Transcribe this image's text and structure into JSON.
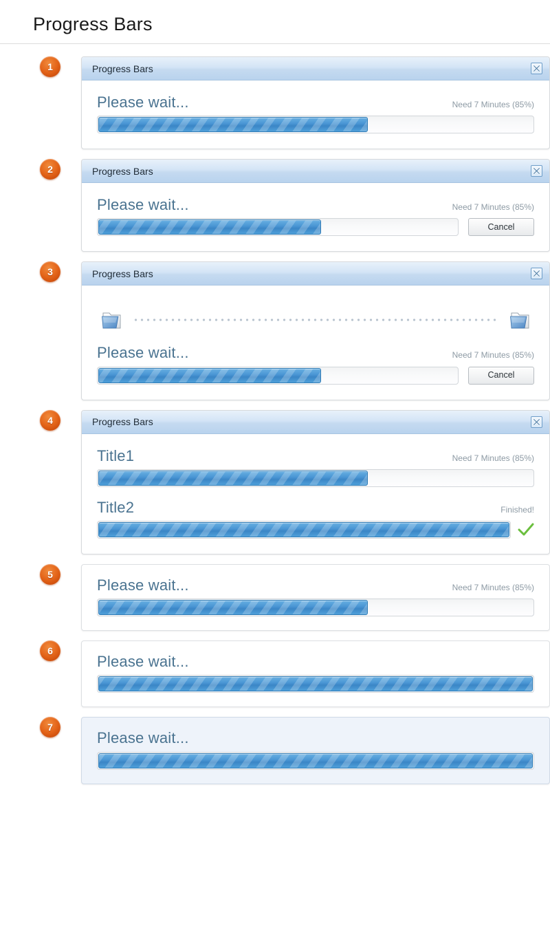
{
  "page": {
    "title": "Progress Bars"
  },
  "common": {
    "dialog_title": "Progress Bars",
    "please_wait": "Please wait...",
    "status_85": "Need 7 Minutes (85%)",
    "status_finished": "Finished!",
    "cancel_label": "Cancel",
    "close_icon": "close-icon",
    "folder_icon": "folder-icon",
    "check_icon": "check-icon",
    "accent_blue": "#4a96d4",
    "badge_orange": "#e4651a",
    "label_blue": "#4a7390",
    "status_gray": "#8d9aa4"
  },
  "examples": [
    {
      "number": "1",
      "has_titlebar": true,
      "title": "Progress Bars",
      "tinted": false,
      "has_transfer": false,
      "bars": [
        {
          "label": "Please wait...",
          "status": "Need 7 Minutes (85%)",
          "percent": 62,
          "cancel": false,
          "check": false
        }
      ]
    },
    {
      "number": "2",
      "has_titlebar": true,
      "title": "Progress Bars",
      "tinted": false,
      "has_transfer": false,
      "bars": [
        {
          "label": "Please wait...",
          "status": "Need 7 Minutes (85%)",
          "percent": 62,
          "cancel": true,
          "cancel_label": "Cancel",
          "check": false
        }
      ]
    },
    {
      "number": "3",
      "has_titlebar": true,
      "title": "Progress Bars",
      "tinted": false,
      "has_transfer": true,
      "bars": [
        {
          "label": "Please wait...",
          "status": "Need 7 Minutes (85%)",
          "percent": 62,
          "cancel": true,
          "cancel_label": "Cancel",
          "check": false
        }
      ]
    },
    {
      "number": "4",
      "has_titlebar": true,
      "title": "Progress Bars",
      "tinted": false,
      "has_transfer": false,
      "bars": [
        {
          "label": "Title1",
          "status": "Need 7 Minutes (85%)",
          "percent": 62,
          "cancel": false,
          "check": false
        },
        {
          "label": "Title2",
          "status": "Finished!",
          "percent": 100,
          "cancel": false,
          "check": true
        }
      ]
    },
    {
      "number": "5",
      "has_titlebar": false,
      "tinted": false,
      "has_transfer": false,
      "bars": [
        {
          "label": "Please wait...",
          "status": "Need 7 Minutes (85%)",
          "percent": 62,
          "cancel": false,
          "check": false
        }
      ]
    },
    {
      "number": "6",
      "has_titlebar": false,
      "tinted": false,
      "has_transfer": false,
      "bars": [
        {
          "label": "Please wait...",
          "status": "",
          "percent": 100,
          "cancel": false,
          "check": false
        }
      ]
    },
    {
      "number": "7",
      "has_titlebar": false,
      "tinted": true,
      "has_transfer": false,
      "bars": [
        {
          "label": "Please wait...",
          "status": "",
          "percent": 100,
          "cancel": false,
          "check": false
        }
      ]
    }
  ]
}
